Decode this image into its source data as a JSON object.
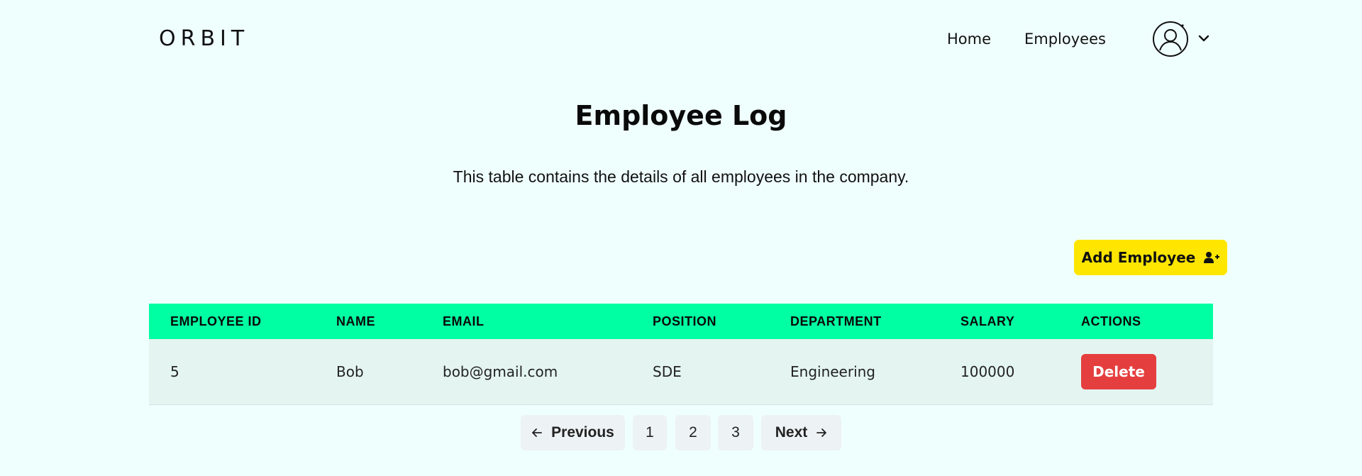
{
  "header": {
    "logo": "ORBIT",
    "nav": [
      {
        "label": "Home"
      },
      {
        "label": "Employees"
      }
    ],
    "avatar_icon": "user-circle-icon",
    "menu_icon": "chevron-down-icon"
  },
  "main": {
    "title": "Employee Log",
    "subtitle": "This table contains the details of all employees in the company.",
    "add_button": {
      "label": "Add Employee",
      "icon": "user-plus-icon",
      "color": "#ffe600"
    },
    "table": {
      "header_color": "#00ffa2",
      "columns": [
        "EMPLOYEE ID",
        "NAME",
        "EMAIL",
        "POSITION",
        "DEPARTMENT",
        "SALARY",
        "ACTIONS"
      ],
      "rows": [
        {
          "employee_id": "5",
          "name": "Bob",
          "email": "bob@gmail.com",
          "position": "SDE",
          "department": "Engineering",
          "salary": "100000",
          "action_label": "Delete"
        }
      ],
      "delete_color": "#e53e3e"
    },
    "pagination": {
      "previous": "Previous",
      "pages": [
        "1",
        "2",
        "3"
      ],
      "next": "Next",
      "prev_icon": "arrow-left-icon",
      "next_icon": "arrow-right-icon"
    }
  }
}
